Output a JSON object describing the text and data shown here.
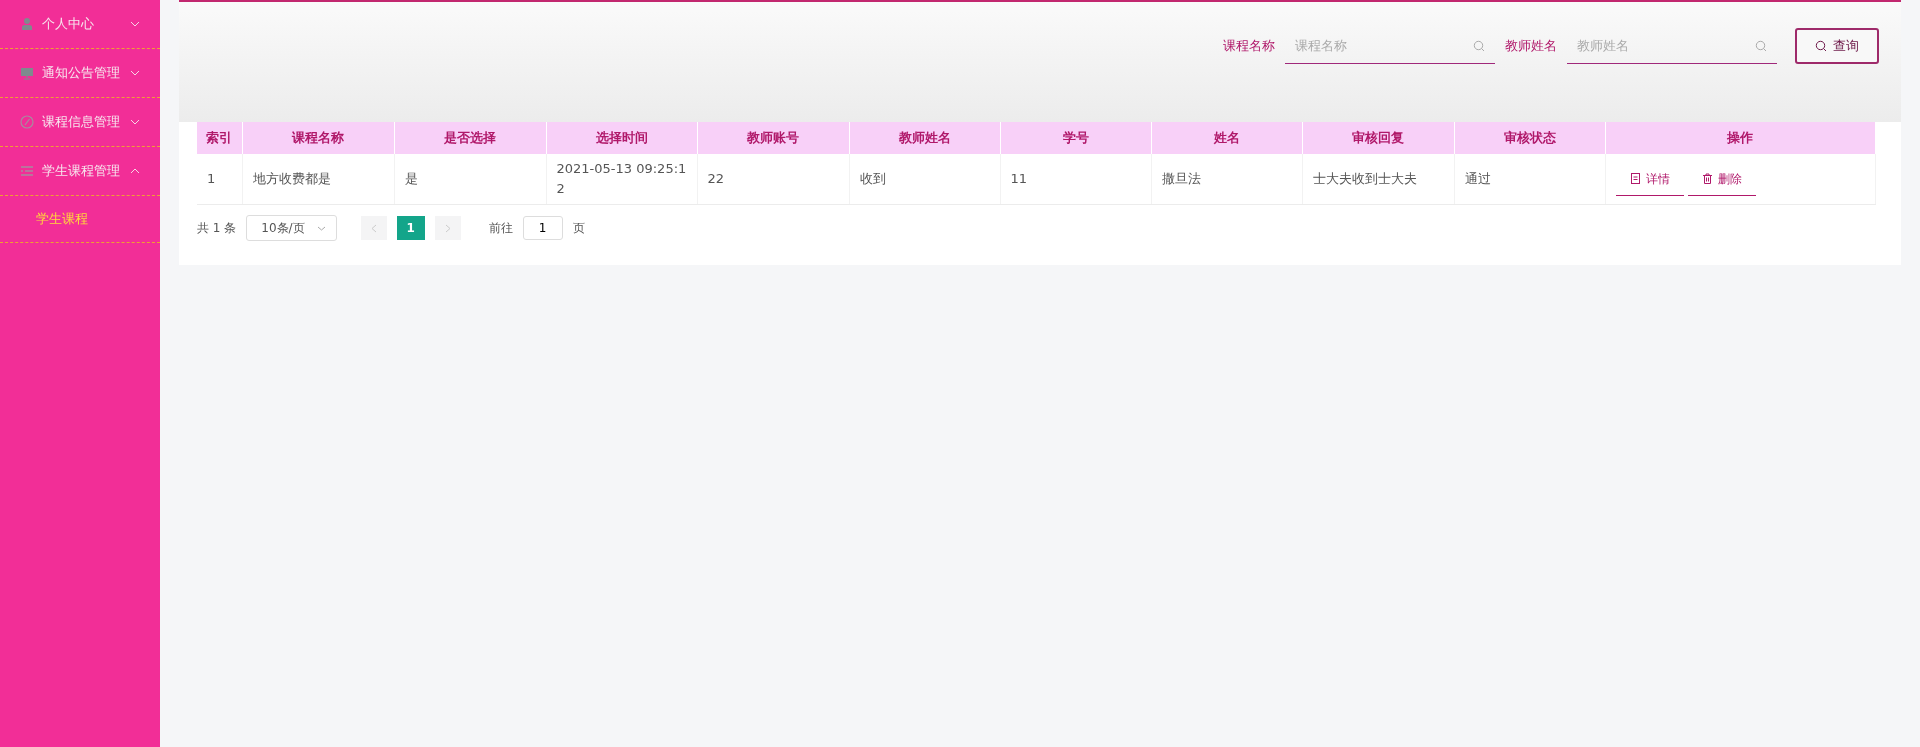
{
  "sidebar": {
    "items": [
      {
        "label": "个人中心",
        "expanded": false
      },
      {
        "label": "通知公告管理",
        "expanded": false
      },
      {
        "label": "课程信息管理",
        "expanded": false
      },
      {
        "label": "学生课程管理",
        "expanded": true,
        "children": [
          {
            "label": "学生课程",
            "selected": true
          }
        ]
      }
    ]
  },
  "search": {
    "fields": [
      {
        "label": "课程名称",
        "placeholder": "课程名称"
      },
      {
        "label": "教师姓名",
        "placeholder": "教师姓名"
      }
    ],
    "button": "查询"
  },
  "table": {
    "columns": [
      "索引",
      "课程名称",
      "是否选择",
      "选择时间",
      "教师账号",
      "教师姓名",
      "学号",
      "姓名",
      "审核回复",
      "审核状态",
      "操作"
    ],
    "rows": [
      {
        "cells": [
          "1",
          "地方收费都是",
          "是",
          "2021-05-13 09:25:12",
          "22",
          "收到",
          "11",
          "撒旦法",
          "士大夫收到士大夫",
          "通过"
        ],
        "actions": [
          {
            "kind": "detail",
            "label": "详情"
          },
          {
            "kind": "delete",
            "label": "删除"
          }
        ]
      }
    ]
  },
  "pagination": {
    "total": "共 1 条",
    "page_size": "10条/页",
    "pages": [
      {
        "label": "1",
        "selected": true
      }
    ],
    "goto_label": "前往",
    "goto_value": "1",
    "page_unit": "页"
  }
}
